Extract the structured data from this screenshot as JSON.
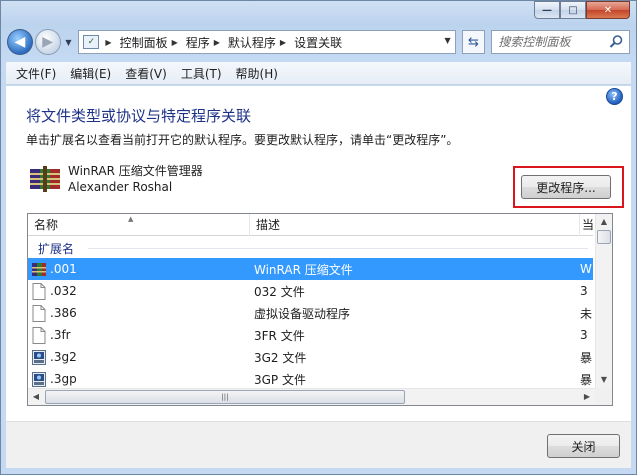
{
  "window": {
    "minimize_glyph": "—",
    "maximize_glyph": "□",
    "close_glyph": "✕"
  },
  "nav": {
    "back_glyph": "◀",
    "forward_glyph": "▶",
    "breadcrumb": [
      "控制面板",
      "程序",
      "默认程序",
      "设置关联"
    ],
    "search_placeholder": "搜索控制面板"
  },
  "menu": [
    "文件(F)",
    "编辑(E)",
    "查看(V)",
    "工具(T)",
    "帮助(H)"
  ],
  "content": {
    "help_glyph": "?",
    "title": "将文件类型或协议与特定程序关联",
    "description": "单击扩展名以查看当前打开它的默认程序。要更改默认程序，请单击“更改程序”。",
    "program_name": "WinRAR 压缩文件管理器",
    "program_author": "Alexander Roshal",
    "change_button": "更改程序..."
  },
  "list": {
    "columns": [
      "名称",
      "描述",
      "当"
    ],
    "group": "扩展名",
    "rows": [
      {
        "ext": ".001",
        "desc": "WinRAR 压缩文件",
        "cur": "W",
        "icon": "winrar",
        "selected": true
      },
      {
        "ext": ".032",
        "desc": "032 文件",
        "cur": "3",
        "icon": "blank",
        "selected": false
      },
      {
        "ext": ".386",
        "desc": "虚拟设备驱动程序",
        "cur": "未",
        "icon": "blank",
        "selected": false
      },
      {
        "ext": ".3fr",
        "desc": "3FR 文件",
        "cur": "3",
        "icon": "blank",
        "selected": false
      },
      {
        "ext": ".3g2",
        "desc": "3G2 文件",
        "cur": "暴",
        "icon": "media",
        "selected": false
      },
      {
        "ext": ".3gp",
        "desc": "3GP 文件",
        "cur": "暴",
        "icon": "media",
        "selected": false
      }
    ],
    "hscroll_grip": "|||"
  },
  "footer": {
    "close_button": "关闭"
  }
}
